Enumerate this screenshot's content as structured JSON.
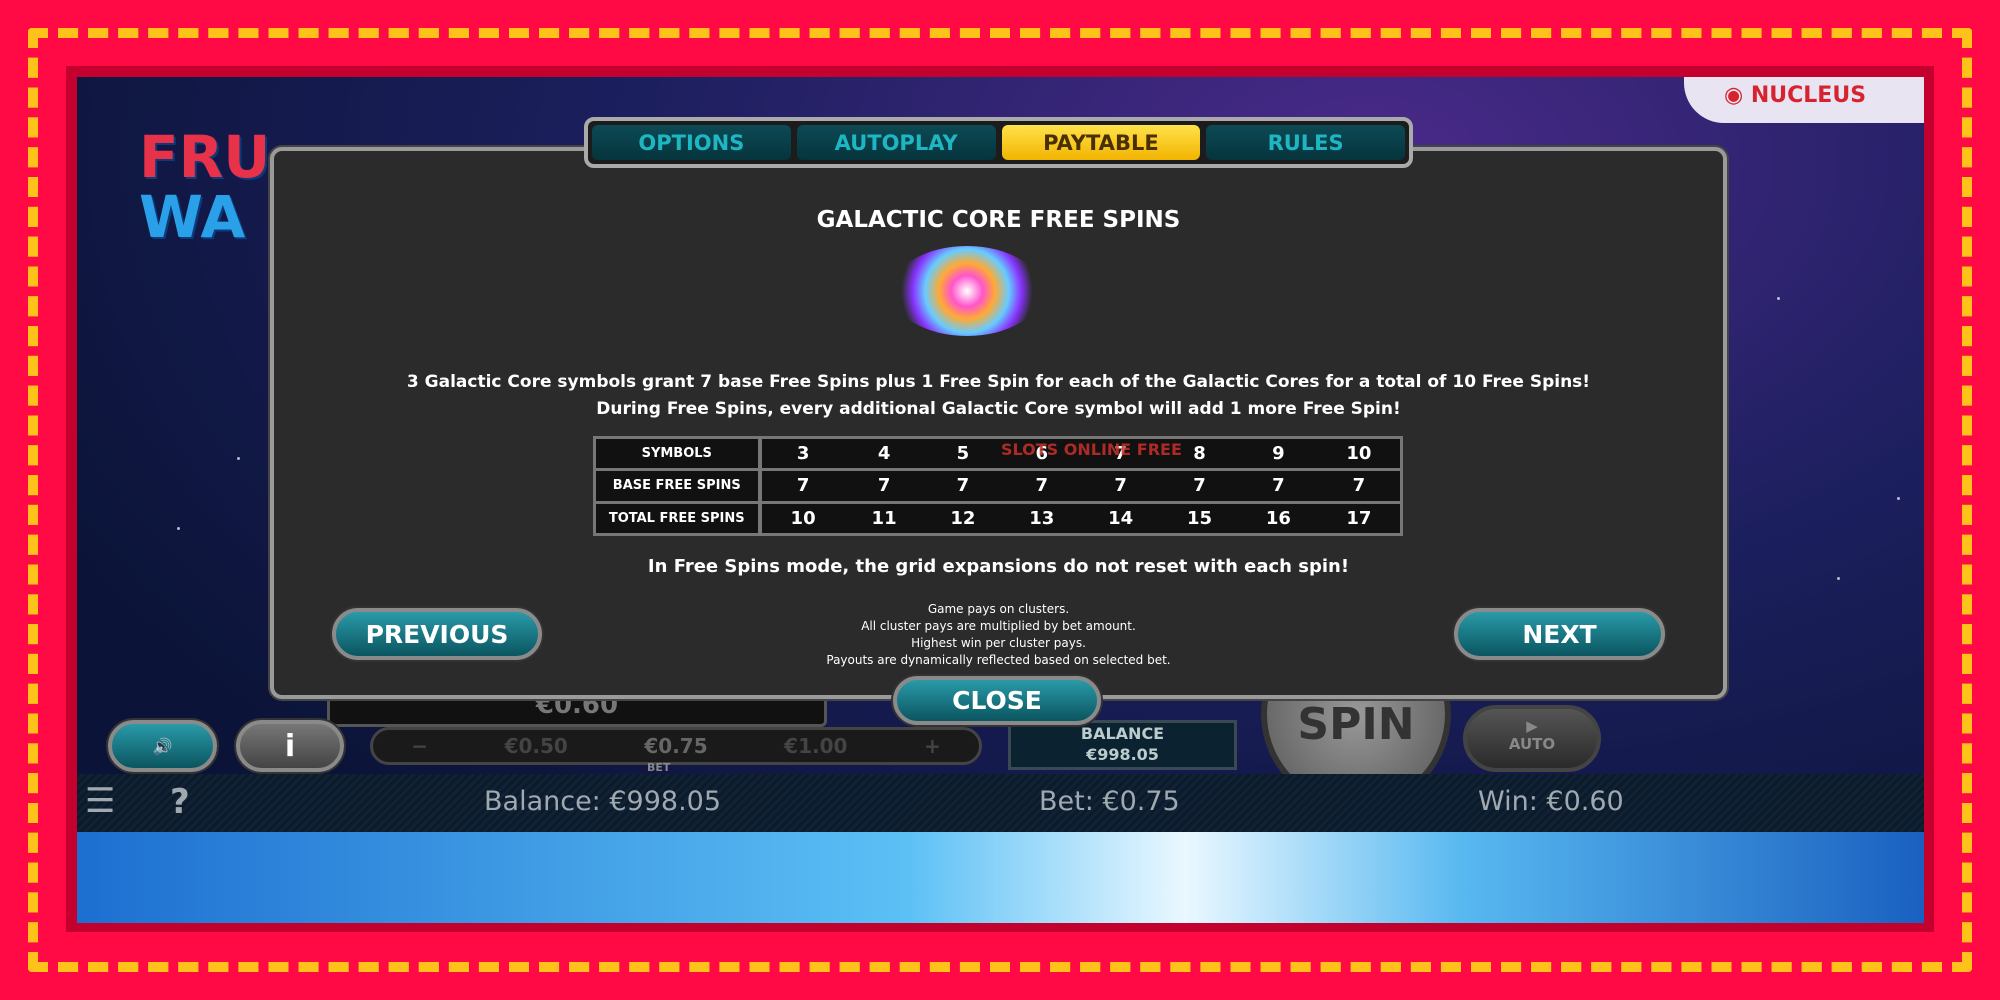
{
  "brand": {
    "game_logo": "FRUITY WAYS",
    "provider_logo": "NUCLEUS GAMING"
  },
  "tabs": [
    {
      "label": "OPTIONS",
      "active": false
    },
    {
      "label": "AUTOPLAY",
      "active": false
    },
    {
      "label": "PAYTABLE",
      "active": true
    },
    {
      "label": "RULES",
      "active": false
    }
  ],
  "paytable": {
    "title": "GALACTIC CORE FREE SPINS",
    "line1": "3 Galactic Core symbols grant 7 base Free Spins plus 1 Free Spin for each of the Galactic Cores for a total of 10 Free Spins!",
    "line2": "During Free Spins, every additional Galactic Core symbol will add 1 more Free Spin!",
    "table": {
      "rows": [
        {
          "label": "SYMBOLS",
          "values": [
            "3",
            "4",
            "5",
            "6",
            "7",
            "8",
            "9",
            "10"
          ]
        },
        {
          "label": "BASE FREE SPINS",
          "values": [
            "7",
            "7",
            "7",
            "7",
            "7",
            "7",
            "7",
            "7"
          ]
        },
        {
          "label": "TOTAL FREE SPINS",
          "values": [
            "10",
            "11",
            "12",
            "13",
            "14",
            "15",
            "16",
            "17"
          ]
        }
      ]
    },
    "note": "In Free Spins mode, the grid expansions do not reset with each spin!",
    "rules": [
      "Game pays on clusters.",
      "All cluster pays are multiplied by bet amount.",
      "Highest win per cluster pays.",
      "Payouts are dynamically reflected based on selected bet."
    ]
  },
  "watermark": "SLOTS ONLINE FREE",
  "buttons": {
    "previous": "PREVIOUS",
    "next": "NEXT",
    "close": "CLOSE"
  },
  "controls": {
    "win_partial": "€0.60",
    "bet_options": [
      "€0.50",
      "€0.75",
      "€1.00"
    ],
    "bet_label": "BET",
    "balance_label": "BALANCE",
    "balance_value": "€998.05",
    "spin": "SPIN",
    "auto": "AUTO"
  },
  "statusbar": {
    "balance": "Balance: €998.05",
    "bet": "Bet: €0.75",
    "win": "Win: €0.60"
  },
  "colors": {
    "frame": "#ff0a45",
    "dashes": "#ffc21a",
    "active_tab": "#f2b400",
    "teal": "#1fb6c4"
  }
}
